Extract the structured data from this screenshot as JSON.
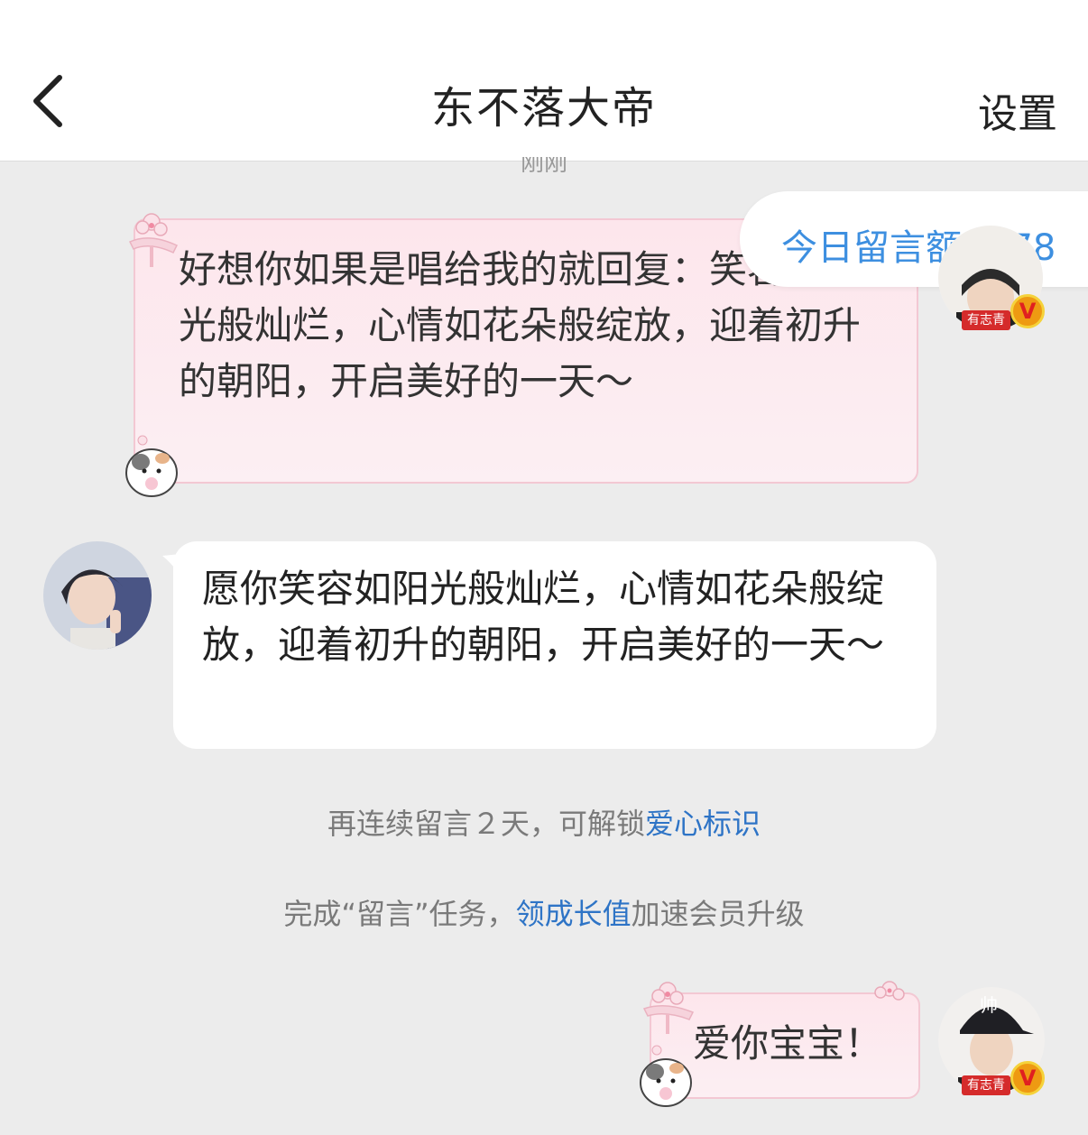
{
  "header": {
    "title": "东不落大帝",
    "settings_label": "设置"
  },
  "timestamp": "刚刚",
  "quota": {
    "label": "今日留言额度:78"
  },
  "messages": [
    {
      "side": "right",
      "style": "pink-sticker",
      "text": "好想你如果是唱给我的就回复：笑容如阳光般灿烂，心情如花朵般绽放，迎着初升的朝阳，开启美好的一天～",
      "avatar_label": "有志青",
      "avatar_cap_text": "",
      "verified": "V"
    },
    {
      "side": "left",
      "style": "white",
      "text": "愿你笑容如阳光般灿烂，心情如花朵般绽放，迎着初升的朝阳，开启美好的一天～"
    },
    {
      "side": "right",
      "style": "pink-sticker",
      "text": "爱你宝宝！",
      "avatar_label": "有志青",
      "avatar_cap_text": "帅",
      "verified": "V"
    }
  ],
  "system": {
    "streak_prefix": "再连续留言２天，可解锁",
    "streak_link": "爱心标识",
    "task_prefix": "完成“留言”任务，",
    "task_link": "领成长值",
    "task_suffix": "加速会员升级"
  },
  "colors": {
    "accent": "#3d8fe0",
    "link": "#2e74c6",
    "bubble_pink": "#fde6ec",
    "background": "#ececec"
  },
  "icons": [
    "back-arrow-icon",
    "sakura-icon",
    "hamster-sticker-icon",
    "verified-v-icon"
  ]
}
